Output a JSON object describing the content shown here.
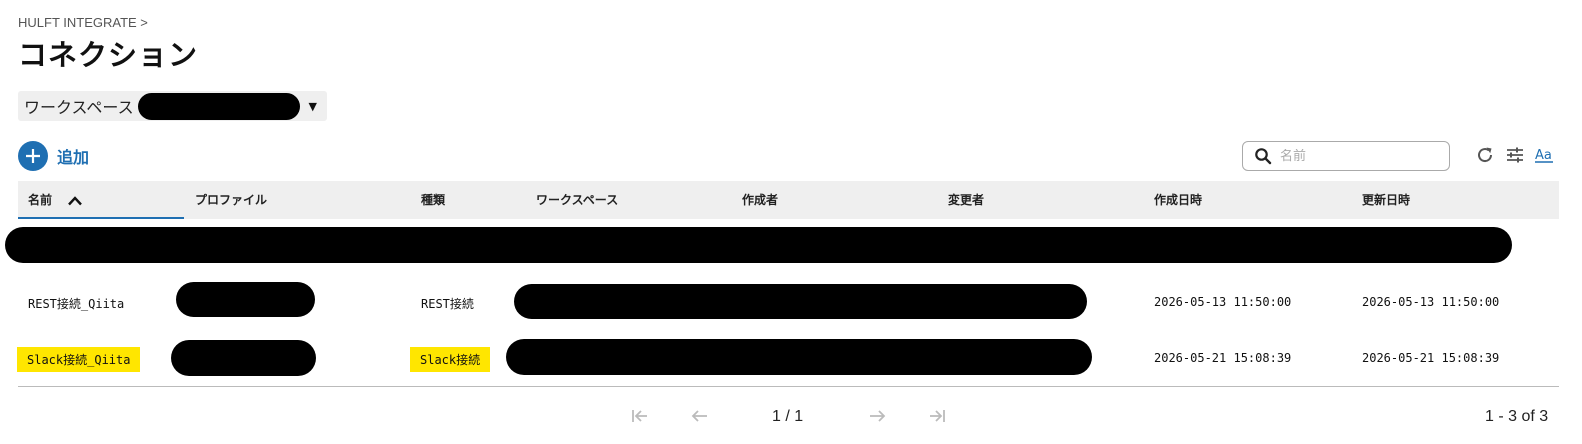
{
  "breadcrumb": "HULFT INTEGRATE >",
  "title": "コネクション",
  "workspace_selector": {
    "label": "ワークスペース"
  },
  "add_button": {
    "label": "追加"
  },
  "search": {
    "placeholder": "名前"
  },
  "colors": {
    "accent": "#1f6fb2",
    "highlight": "#ffe600",
    "header_bg": "#efefef"
  },
  "icons": [
    "plus-icon",
    "search-icon",
    "refresh-icon",
    "filter-settings-icon",
    "font-size-icon",
    "first-page-icon",
    "prev-page-icon",
    "next-page-icon",
    "last-page-icon"
  ],
  "table": {
    "columns": [
      "名前",
      "プロファイル",
      "種類",
      "ワークスペース",
      "作成者",
      "変更者",
      "作成日時",
      "更新日時"
    ],
    "sort": {
      "column": "名前",
      "direction": "ascending"
    },
    "rows": [
      {
        "name": "REST接続_Qiita",
        "type": "REST接続",
        "created": "2026-05-13 11:50:00",
        "updated": "2026-05-13 11:50:00"
      },
      {
        "name": "Slack接続_Qiita",
        "type": "Slack接続",
        "created": "2026-05-21 15:08:39",
        "updated": "2026-05-21 15:08:39"
      }
    ]
  },
  "pagination": {
    "page": "1 / 1",
    "range": "1 - 3 of 3"
  }
}
